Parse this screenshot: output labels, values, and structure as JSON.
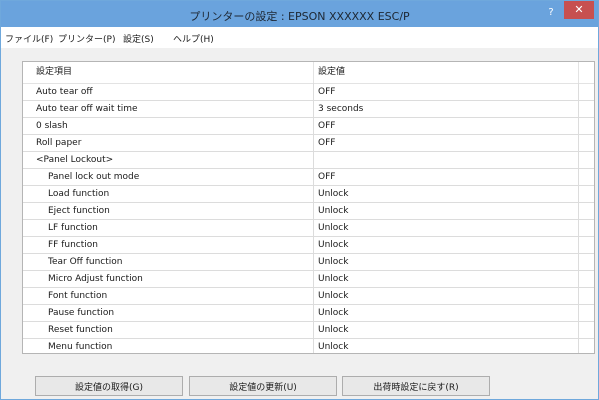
{
  "window": {
    "title": "プリンターの設定 : EPSON XXXXXX ESC/P",
    "help_label": "?",
    "close_label": "✕"
  },
  "menu": [
    "ファイル(F)",
    "プリンター(P)",
    "設定(S)",
    "ヘルプ(H)"
  ],
  "table": {
    "headers": [
      "設定項目",
      "設定値"
    ],
    "rows": [
      {
        "name": "Auto tear off",
        "value": "OFF",
        "indent": false
      },
      {
        "name": "Auto tear off wait time",
        "value": "3 seconds",
        "indent": false
      },
      {
        "name": "0 slash",
        "value": "OFF",
        "indent": false
      },
      {
        "name": "Roll paper",
        "value": "OFF",
        "indent": false
      },
      {
        "name": "<Panel Lockout>",
        "value": "",
        "indent": false
      },
      {
        "name": "Panel lock out mode",
        "value": "OFF",
        "indent": true
      },
      {
        "name": "Load function",
        "value": "Unlock",
        "indent": true
      },
      {
        "name": "Eject function",
        "value": "Unlock",
        "indent": true
      },
      {
        "name": "LF function",
        "value": "Unlock",
        "indent": true
      },
      {
        "name": "FF function",
        "value": "Unlock",
        "indent": true
      },
      {
        "name": "Tear Off function",
        "value": "Unlock",
        "indent": true
      },
      {
        "name": "Micro Adjust function",
        "value": "Unlock",
        "indent": true
      },
      {
        "name": "Font function",
        "value": "Unlock",
        "indent": true
      },
      {
        "name": "Pause function",
        "value": "Unlock",
        "indent": true
      },
      {
        "name": "Reset function",
        "value": "Unlock",
        "indent": true
      },
      {
        "name": "Menu function",
        "value": "Unlock",
        "indent": true
      }
    ]
  },
  "buttons": {
    "get": "設定値の取得(G)",
    "update": "設定値の更新(U)",
    "reset": "出荷時設定に戻す(R)"
  },
  "colors": {
    "titlebar": "#6aa3dd",
    "close": "#c75050"
  }
}
